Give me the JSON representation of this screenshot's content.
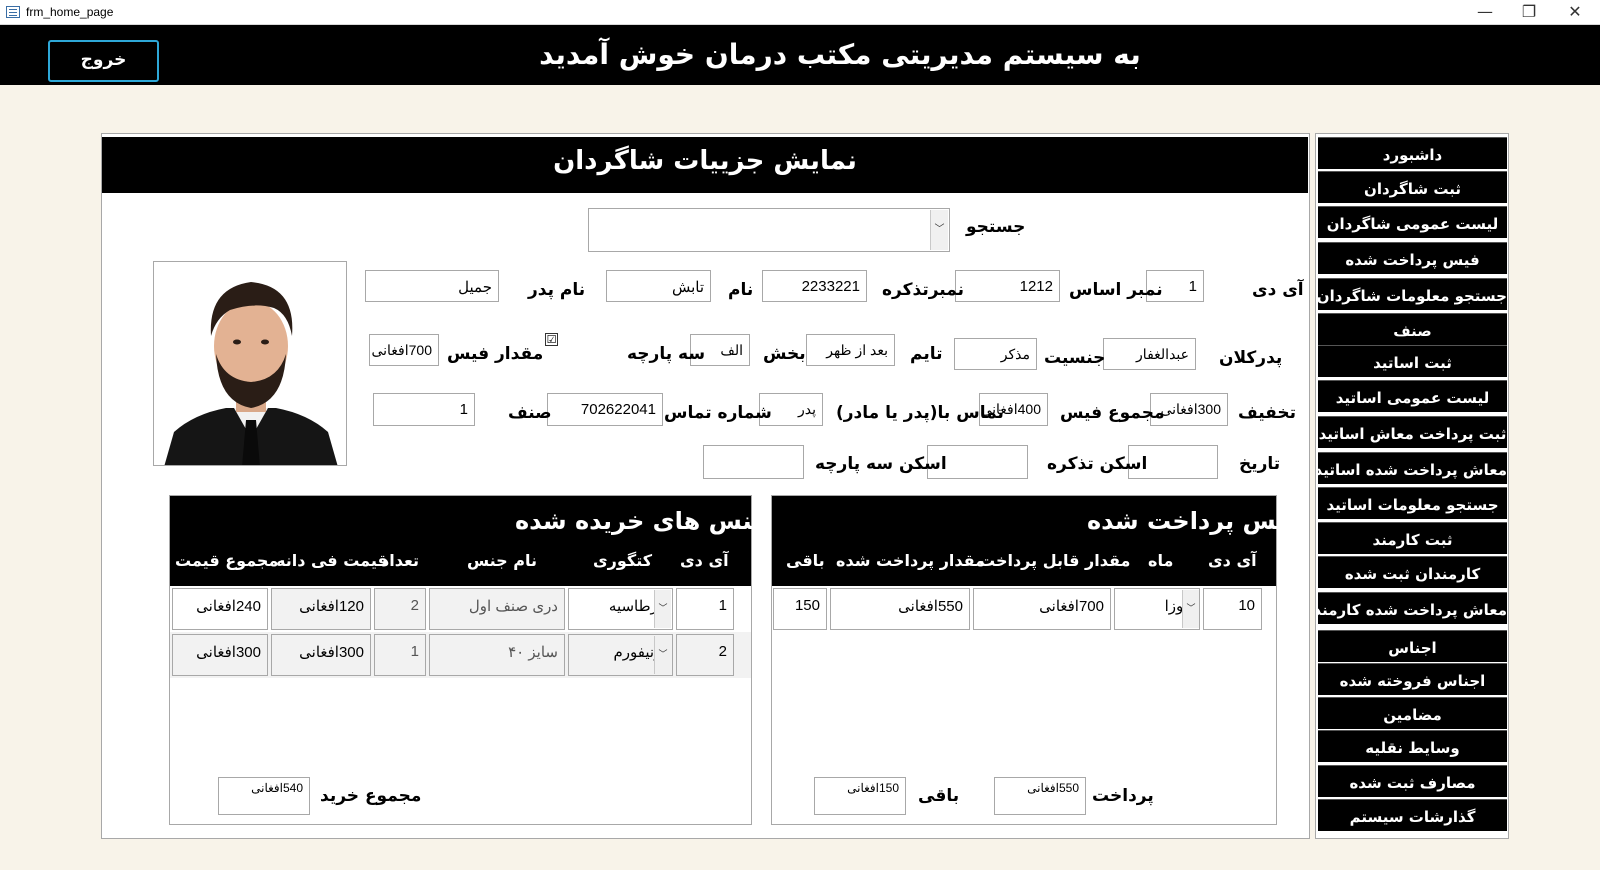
{
  "window": {
    "title": "frm_home_page",
    "minimize": "—",
    "restore": "❐",
    "close": "✕"
  },
  "header": {
    "exit_label": "خروج",
    "welcome": "به سیستم مدیریتی  مکتب درمان خوش آمدید"
  },
  "panel": {
    "title": "نمایش جزییات شاگردان"
  },
  "form": {
    "search_label": "جستجو",
    "search_value": "",
    "id_label": "آی دی",
    "id_value": "1",
    "base_no_label": "نمبر اساس",
    "base_no_value": "1212",
    "tazkira_no_label": "نمبرتذکره",
    "tazkira_no_value": "2233221",
    "name_label": "نام",
    "name_value": "تابش",
    "father_label": "نام پدر",
    "father_value": "جمیل",
    "grandfather_label": "پدرکلان",
    "grandfather_value": "عبدالغفار",
    "gender_label": "جنسیت",
    "gender_value": "مذکر",
    "time_label": "تایم",
    "time_value": "بعد از ظهر",
    "section_label": "بخش",
    "section_value": "الف",
    "three_part_label": "سه پارچه",
    "three_part_checked": "☑",
    "fee_amount_label": "مقدار فیس",
    "fee_amount_value": "700افغانی",
    "discount_label": "تخفیف",
    "discount_value": "300افغانی",
    "total_fee_label": "مجموع فیس",
    "total_fee_value": "400افغانی",
    "contact_with_label": "تماس با(پدر یا مادر)",
    "contact_with_value": "پدر",
    "phone_label": "شماره تماس",
    "phone_value": "702622041",
    "class_label": "صنف",
    "class_value": "1",
    "date_label": "تاریخ",
    "date_value": "",
    "tazkira_scan_label": "اسکن تذکره",
    "tazkira_scan_value": "",
    "three_part_scan_label": "اسکن سه پارچه",
    "three_part_scan_value": ""
  },
  "fees": {
    "title": "فیس پرداخت شده",
    "columns": [
      "آی دی",
      "ماه",
      "مقدار قابل پرداخت",
      "مقدار پرداخت شده",
      "باقی"
    ],
    "rows": [
      {
        "id": "10",
        "month": "جوزا",
        "payable": "700افغانی",
        "paid": "550افغانی",
        "remaining": "150"
      }
    ],
    "payment_label": "پرداخت",
    "payment_value": "550افغانی",
    "remaining_label": "باقی",
    "remaining_value": "150افغانی"
  },
  "purchases": {
    "title": "جنس های خریده شده",
    "columns": [
      "آی دی",
      "کتگوری",
      "نام جنس",
      "تعداد",
      "قیمت فی دانه",
      "مجموع قیمت"
    ],
    "rows": [
      {
        "id": "1",
        "category": "قرطاسیه",
        "item": "دری صنف اول",
        "qty": "2",
        "unit_price": "120افغانی",
        "total": "240افغانی"
      },
      {
        "id": "2",
        "category": "یونیفورم",
        "item": "سایز ۴۰",
        "qty": "1",
        "unit_price": "300افغانی",
        "total": "300افغانی"
      }
    ],
    "total_label": "مجموع خرید",
    "total_value": "540افغانی"
  },
  "nav": {
    "items": [
      "داشبورد",
      "ثبت شاگردان",
      "لیست عمومی شاگردان",
      "فیس پرداخت شده",
      "جستجو معلومات شاگردان",
      "صنف",
      "ثبت اساتید",
      "لیست عمومی اساتید",
      "ثبت پرداخت معاش اساتید",
      "معاش پرداخت شده اساتید",
      "جستجو معلومات اساتید",
      "ثبت کارمند",
      "کارمندان ثبت شده",
      "معاش پرداخت شده کارمندان",
      "اجناس",
      "اجناس فروخته شده",
      "مضامین",
      "وسایط نقلیه",
      "مصارف ثبت شده",
      "گذارشات سیستم"
    ]
  },
  "colors": {
    "accent": "#2ea8d8",
    "bar": "#000000",
    "background": "#f8f3e9"
  }
}
